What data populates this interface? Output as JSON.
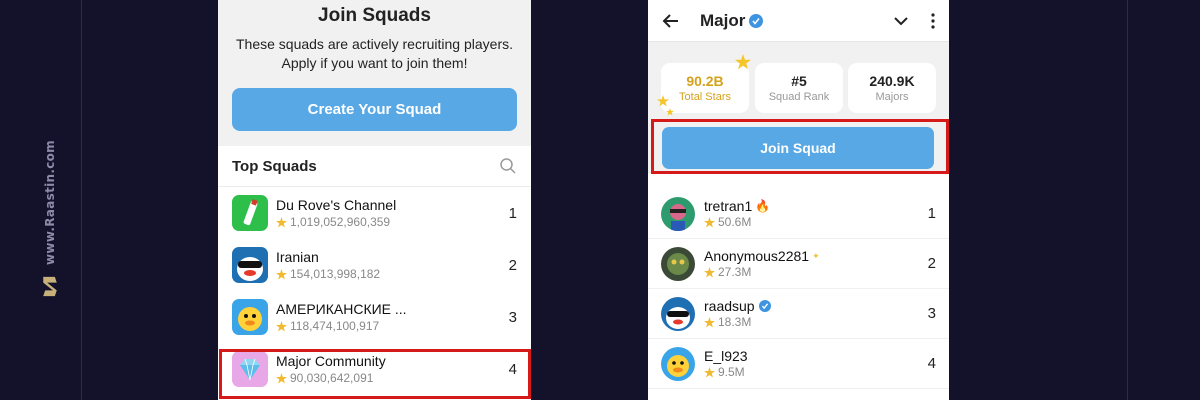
{
  "watermark": {
    "text": "www.Raastin.com"
  },
  "left": {
    "title": "Join Squads",
    "subtitle_line1": "These squads are actively recruiting players.",
    "subtitle_line2": "Apply if you want to join them!",
    "create_button": "Create Your Squad",
    "top_squads_label": "Top Squads",
    "squads": [
      {
        "name": "Du Rove's Channel",
        "score": "1,019,052,960,359",
        "rank": "1",
        "icon": "bottle-icon"
      },
      {
        "name": "Iranian",
        "score": "154,013,998,182",
        "rank": "2",
        "icon": "duck-sunglasses-icon"
      },
      {
        "name": "АМЕРИКАНСКИЕ ...",
        "score": "118,474,100,917",
        "rank": "3",
        "icon": "duck-icon"
      },
      {
        "name": "Major Community",
        "score": "90,030,642,091",
        "rank": "4",
        "icon": "diamond-icon"
      }
    ]
  },
  "right": {
    "title": "Major",
    "stats": [
      {
        "value": "90.2B",
        "label": "Total Stars"
      },
      {
        "value": "#5",
        "label": "Squad Rank"
      },
      {
        "value": "240.9K",
        "label": "Majors"
      }
    ],
    "join_button": "Join Squad",
    "members": [
      {
        "name": "tretran1",
        "score": "50.6M",
        "rank": "1",
        "badge": "fire-icon"
      },
      {
        "name": "Anonymous2281",
        "score": "27.3M",
        "rank": "2",
        "badge": "sparkle-icon"
      },
      {
        "name": "raadsup",
        "score": "18.3M",
        "rank": "3",
        "badge": "verified-icon"
      },
      {
        "name": "E_l923",
        "score": "9.5M",
        "rank": "4",
        "badge": ""
      }
    ]
  },
  "colors": {
    "accent_blue": "#58a8e6",
    "highlight_red": "#d61a1a",
    "gold": "#d4a21d",
    "background": "#14122a"
  }
}
